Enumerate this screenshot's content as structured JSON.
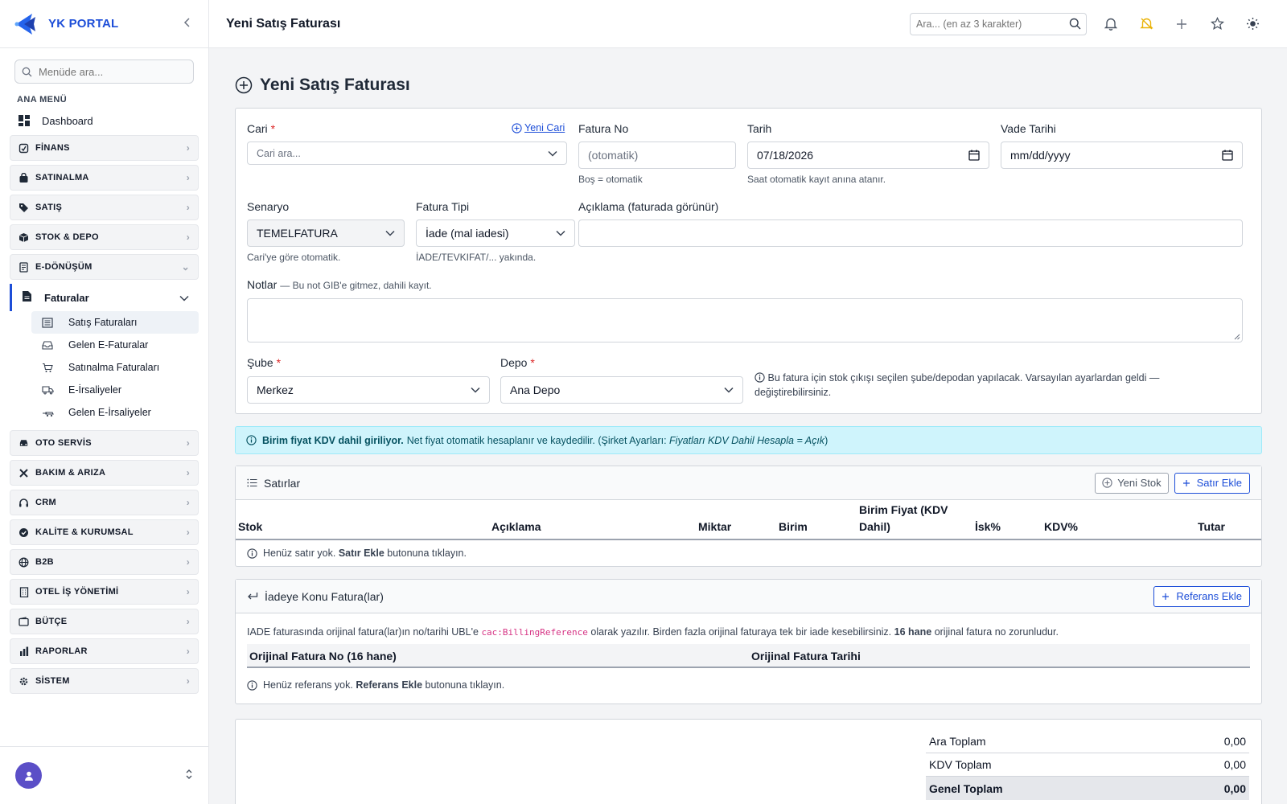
{
  "sidebar": {
    "brand": "YK PORTAL",
    "search_placeholder": "Menüde ara...",
    "section_title": "ANA MENÜ",
    "dashboard": "Dashboard",
    "groups_top": [
      {
        "label": "FİNANS",
        "icon": "finance-icon"
      },
      {
        "label": "SATINALMA",
        "icon": "bag-icon"
      },
      {
        "label": "SATIŞ",
        "icon": "tag-icon"
      },
      {
        "label": "STOK & DEPO",
        "icon": "box-icon"
      },
      {
        "label": "E-DÖNÜŞÜM",
        "icon": "document-icon"
      }
    ],
    "open_submenu": "Faturalar",
    "leaves": [
      {
        "label": "Satış Faturaları",
        "icon": "receipt-icon",
        "active": true
      },
      {
        "label": "Gelen E-Faturalar",
        "icon": "inbox-icon"
      },
      {
        "label": "Satınalma Faturaları",
        "icon": "cart-icon"
      },
      {
        "label": "E-İrsaliyeler",
        "icon": "truck-icon"
      },
      {
        "label": "Gelen E-İrsaliyeler",
        "icon": "truck-in-icon"
      }
    ],
    "groups_bottom": [
      {
        "label": "OTO SERVİS",
        "icon": "car-icon"
      },
      {
        "label": "BAKIM & ARIZA",
        "icon": "tools-icon"
      },
      {
        "label": "CRM",
        "icon": "headset-icon"
      },
      {
        "label": "KALİTE & KURUMSAL",
        "icon": "badge-icon"
      },
      {
        "label": "B2B",
        "icon": "globe-icon"
      },
      {
        "label": "OTEL İŞ YÖNETİMİ",
        "icon": "building-icon"
      },
      {
        "label": "BÜTÇE",
        "icon": "wallet-icon"
      },
      {
        "label": "RAPORLAR",
        "icon": "bar-chart-icon"
      },
      {
        "label": "SİSTEM",
        "icon": "gear-icon"
      }
    ]
  },
  "topbar": {
    "title": "Yeni Satış Faturası",
    "search_placeholder": "Ara... (en az 3 karakter)"
  },
  "page": {
    "title": "Yeni Satış Faturası"
  },
  "form": {
    "cari_label": "Cari",
    "new_cari_link": "Yeni Cari",
    "cari_placeholder": "Cari ara...",
    "fatura_no_label": "Fatura No",
    "fatura_no_placeholder": "(otomatik)",
    "fatura_no_hint": "Boş = otomatik",
    "tarih_label": "Tarih",
    "tarih_value": "07/18/2026",
    "tarih_hint": "Saat otomatik kayıt anına atanır.",
    "vade_label": "Vade Tarihi",
    "vade_placeholder": "mm/dd/yyyy",
    "senaryo_label": "Senaryo",
    "senaryo_value": "TEMELFATURA",
    "senaryo_hint": "Cari'ye göre otomatik.",
    "fatura_tipi_label": "Fatura Tipi",
    "fatura_tipi_value": "İade (mal iadesi)",
    "fatura_tipi_hint": "İADE/TEVKIFAT/... yakında.",
    "aciklama_label": "Açıklama (faturada görünür)",
    "notlar_label": "Notlar",
    "notlar_hint": "— Bu not GIB'e gitmez, dahili kayıt.",
    "sube_label": "Şube",
    "sube_value": "Merkez",
    "depo_label": "Depo",
    "depo_value": "Ana Depo",
    "stock_info": "Bu fatura için stok çıkışı seçilen şube/depodan yapılacak. Varsayılan ayarlardan geldi — değiştirebilirsiniz."
  },
  "alert": {
    "bold": "Birim fiyat KDV dahil giriliyor.",
    "text": "Net fiyat otomatik hesaplanır ve kaydedilir. (Şirket Ayarları:",
    "italic": "Fiyatları KDV Dahil Hesapla = Açık",
    "close": ")"
  },
  "lines": {
    "title": "Satırlar",
    "new_stock_btn": "Yeni Stok",
    "add_row_btn": "Satır Ekle",
    "columns": [
      "Stok",
      "Açıklama",
      "Miktar",
      "Birim",
      "Birim Fiyat (KDV Dahil)",
      "İsk%",
      "KDV%",
      "Tutar"
    ],
    "empty_pre": "Henüz satır yok.",
    "empty_bold": "Satır Ekle",
    "empty_post": "butonuna tıklayın."
  },
  "refs": {
    "title": "İadeye Konu Fatura(lar)",
    "add_btn": "Referans Ekle",
    "desc_pre": "IADE faturasında orijinal fatura(lar)ın no/tarihi UBL'e",
    "desc_code": "cac:BillingReference",
    "desc_mid": "olarak yazılır. Birden fazla orijinal faturaya tek bir iade kesebilirsiniz.",
    "desc_bold": "16 hane",
    "desc_post": "orijinal fatura no zorunludur.",
    "col_no": "Orijinal Fatura No (16 hane)",
    "col_date": "Orijinal Fatura Tarihi",
    "empty_pre": "Henüz referans yok.",
    "empty_bold": "Referans Ekle",
    "empty_post": "butonuna tıklayın."
  },
  "totals": {
    "ara_label": "Ara Toplam",
    "ara_value": "0,00",
    "kdv_label": "KDV Toplam",
    "kdv_value": "0,00",
    "genel_label": "Genel Toplam",
    "genel_value": "0,00"
  },
  "colors": {
    "accent": "#1d4ed8",
    "info_bg": "#cff4fc",
    "info_text": "#055160",
    "avatar": "#5b4fc7"
  }
}
